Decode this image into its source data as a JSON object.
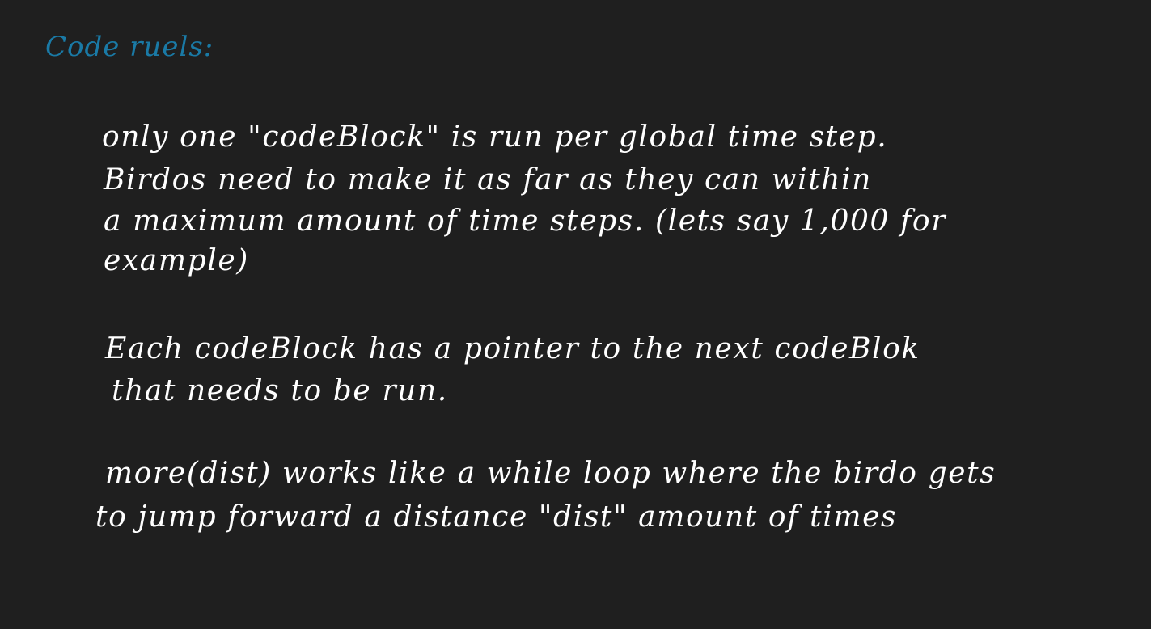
{
  "colors": {
    "background": "#1f1f1f",
    "heading_ink": "#1a7aa6",
    "body_ink": "#ffffff"
  },
  "heading": "Code ruels:",
  "paragraphs": [
    {
      "lines": [
        "only one \"codeBlock\" is run per global time step.",
        "Birdos need to make it as far as they can within",
        "a maximum amount of time steps. (lets say 1,000 for",
        "example)"
      ]
    },
    {
      "lines": [
        "Each codeBlock has a pointer to the next codeBlok",
        "that needs to be run."
      ]
    },
    {
      "lines": [
        "more(dist) works like a while loop where the birdo gets",
        "to jump forward a distance \"dist\" amount of times"
      ]
    }
  ]
}
